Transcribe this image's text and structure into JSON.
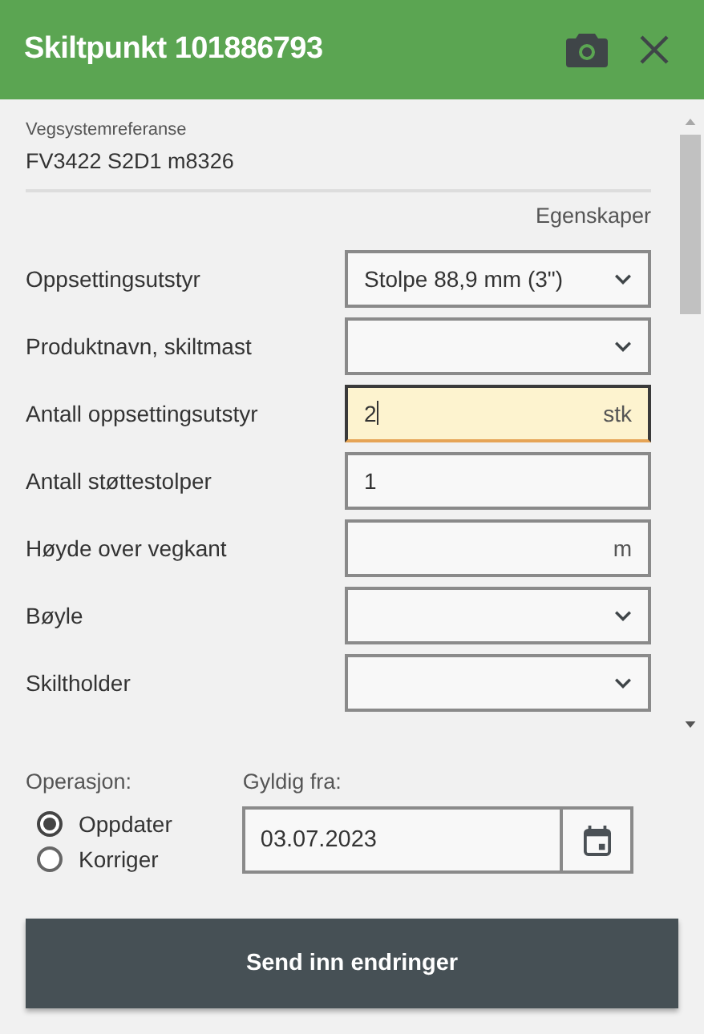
{
  "window": {
    "title": "Skiltpunkt 101886793"
  },
  "reference": {
    "label": "Vegsystemreferanse",
    "value": "FV3422 S2D1 m8326"
  },
  "section_title": "Egenskaper",
  "fields": [
    {
      "label": "Oppsettingsutstyr",
      "kind": "select",
      "value": "Stolpe 88,9 mm (3\")",
      "focused": false
    },
    {
      "label": "Produktnavn, skiltmast",
      "kind": "select",
      "focused": false
    },
    {
      "label": "Antall oppsettingsutstyr",
      "kind": "number",
      "value": "2",
      "unit": "stk",
      "focused": true
    },
    {
      "label": "Antall støttestolper",
      "kind": "number",
      "value": "1",
      "focused": false
    },
    {
      "label": "Høyde over vegkant",
      "kind": "number",
      "unit": "m",
      "focused": false
    },
    {
      "label": "Bøyle",
      "kind": "select",
      "focused": false
    },
    {
      "label": "Skiltholder",
      "kind": "select",
      "focused": false
    }
  ],
  "operation": {
    "label": "Operasjon:",
    "options": [
      {
        "label": "Oppdater",
        "selected": true
      },
      {
        "label": "Korriger",
        "selected": false
      }
    ]
  },
  "valid_from": {
    "label": "Gyldig fra:",
    "value": "03.07.2023"
  },
  "submit_button": "Send inn endringer"
}
